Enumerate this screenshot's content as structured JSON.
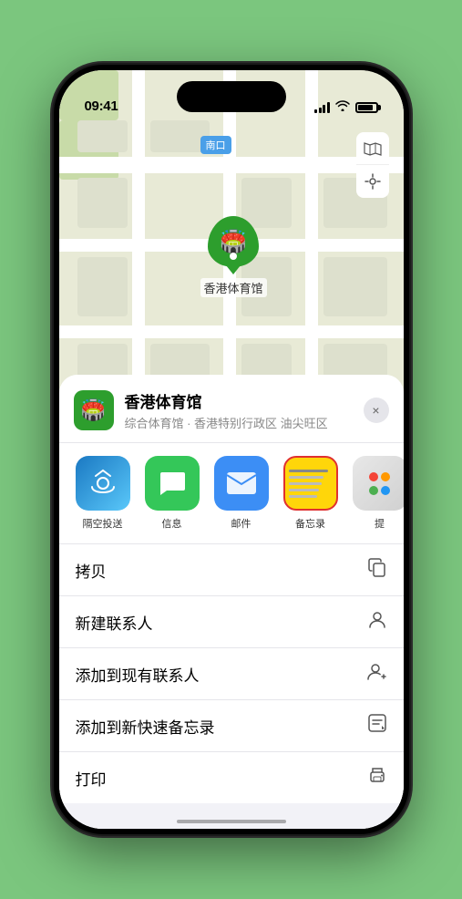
{
  "statusBar": {
    "time": "09:41",
    "locationArrow": "▲"
  },
  "map": {
    "label": "南口",
    "venueName": "香港体育馆",
    "venueLabel": "香港体育馆"
  },
  "sheet": {
    "venueName": "香港体育馆",
    "venueSub": "综合体育馆 · 香港特别行政区 油尖旺区",
    "closeLabel": "×"
  },
  "shareItems": [
    {
      "id": "airdrop",
      "label": "隔空投送"
    },
    {
      "id": "message",
      "label": "信息"
    },
    {
      "id": "mail",
      "label": "邮件"
    },
    {
      "id": "notes",
      "label": "备忘录"
    },
    {
      "id": "more",
      "label": "提"
    }
  ],
  "actions": [
    {
      "id": "copy",
      "label": "拷贝",
      "icon": "copy"
    },
    {
      "id": "new-contact",
      "label": "新建联系人",
      "icon": "person"
    },
    {
      "id": "add-existing",
      "label": "添加到现有联系人",
      "icon": "person-add"
    },
    {
      "id": "add-quick-note",
      "label": "添加到新快速备忘录",
      "icon": "note"
    },
    {
      "id": "print",
      "label": "打印",
      "icon": "print"
    }
  ]
}
